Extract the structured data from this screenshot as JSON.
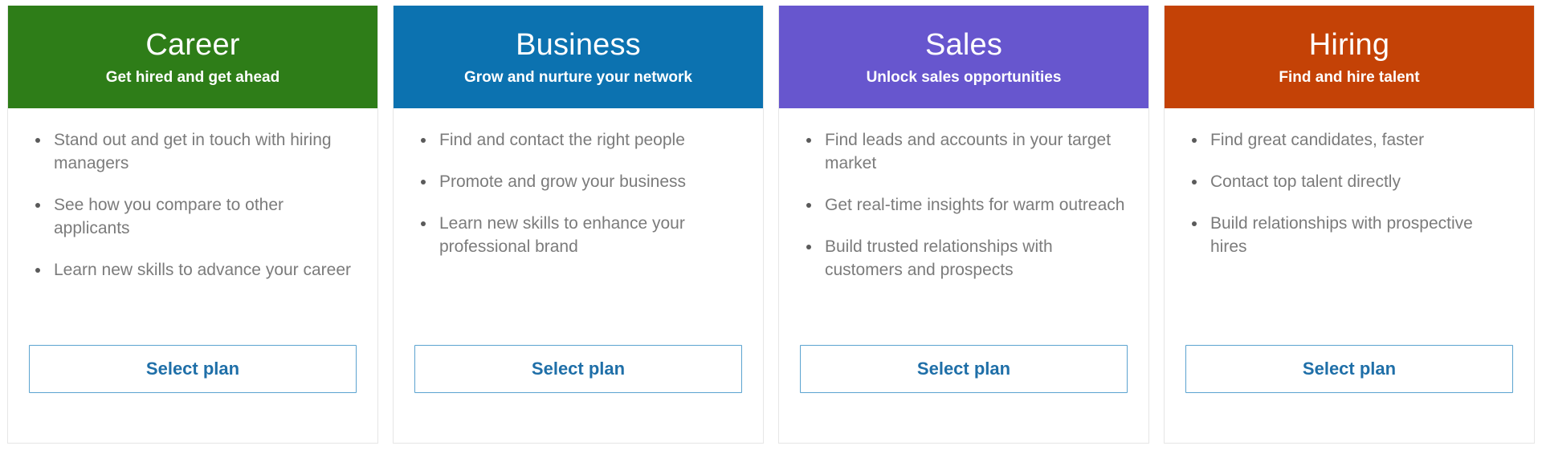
{
  "plans": [
    {
      "id": "career",
      "title": "Career",
      "subtitle": "Get hired and get ahead",
      "header_color": "#2E7D18",
      "features": [
        "Stand out and get in touch with hiring managers",
        "See how you compare to other applicants",
        "Learn new skills to advance your career"
      ],
      "button_label": "Select plan"
    },
    {
      "id": "business",
      "title": "Business",
      "subtitle": "Grow and nurture your network",
      "header_color": "#0C72B0",
      "features": [
        "Find and contact the right people",
        "Promote and grow your business",
        "Learn new skills to enhance your professional brand"
      ],
      "button_label": "Select plan"
    },
    {
      "id": "sales",
      "title": "Sales",
      "subtitle": "Unlock sales opportunities",
      "header_color": "#6756CE",
      "features": [
        "Find leads and accounts in your target market",
        "Get real-time insights for warm outreach",
        "Build trusted relationships with customers and prospects"
      ],
      "button_label": "Select plan"
    },
    {
      "id": "hiring",
      "title": "Hiring",
      "subtitle": "Find and hire talent",
      "header_color": "#C44206",
      "features": [
        "Find great candidates, faster",
        "Contact top talent directly",
        "Build relationships with prospective hires"
      ],
      "button_label": "Select plan"
    }
  ],
  "theme": {
    "button_border_color": "#5ba3d0",
    "button_text_color": "#1f6fa8",
    "body_text_color": "#7b7b7b",
    "card_border_color": "#e6e6e6",
    "bullet_icon": "bullet-dot"
  }
}
